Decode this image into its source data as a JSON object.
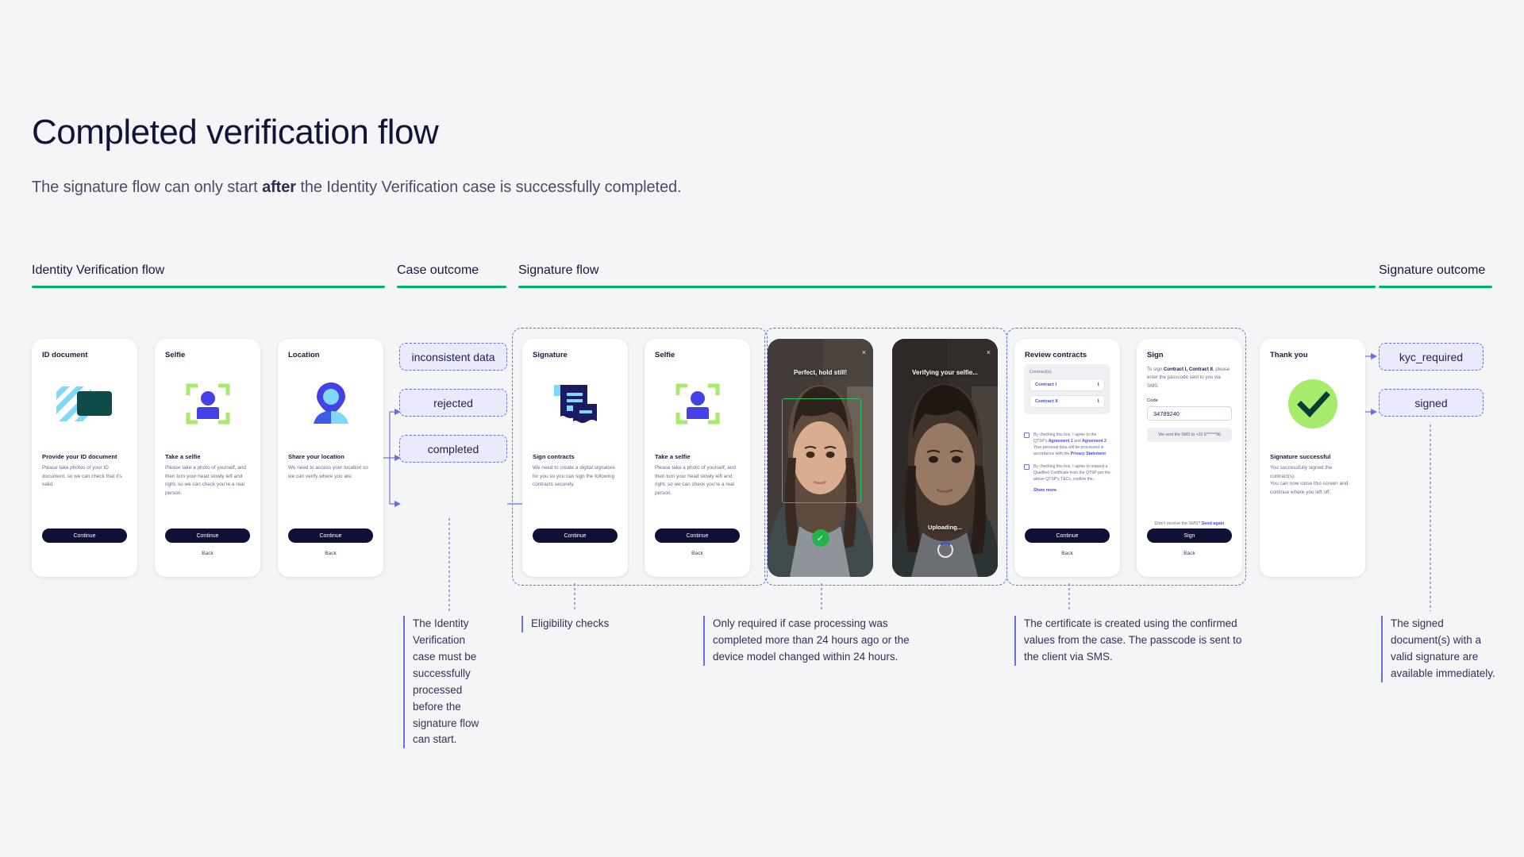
{
  "header": {
    "title": "Completed verification flow",
    "subtitle_pre": "The signature flow can only start ",
    "subtitle_bold": "after",
    "subtitle_post": " the Identity Verification case is successfully completed."
  },
  "sections": [
    {
      "label": "Identity Verification flow"
    },
    {
      "label": "Case outcome"
    },
    {
      "label": "Signature flow"
    },
    {
      "label": "Signature outcome"
    }
  ],
  "screens": {
    "id_document": {
      "title": "ID document",
      "heading": "Provide your ID document",
      "body": "Please take photos of your ID document, so we can check that it's valid.",
      "cta": "Continue",
      "icon": "id-card-icon"
    },
    "selfie": {
      "title": "Selfie",
      "heading": "Take a selfie",
      "body": "Please take a photo of yourself, and then turn your head slowly left and right, so we can check you're a real person.",
      "cta": "Continue",
      "back": "Back",
      "icon": "face-scan-icon"
    },
    "location": {
      "title": "Location",
      "heading": "Share your location",
      "body": "We need to access your location so we can verify where you are.",
      "cta": "Continue",
      "back": "Back",
      "icon": "map-pin-person-icon"
    },
    "signature": {
      "title": "Signature",
      "heading": "Sign contracts",
      "body": "We need to create a digital signature for you so you can sign the following contracts securely.",
      "cta": "Continue",
      "icon": "contract-document-icon"
    },
    "selfie2": {
      "title": "Selfie",
      "heading": "Take a selfie",
      "body": "Please take a photo of yourself, and then turn your head slowly left and right, so we can check you're a real person.",
      "cta": "Continue",
      "back": "Back",
      "icon": "face-scan-icon"
    },
    "camera_hold": {
      "title": "Perfect, hold still!",
      "close": "×",
      "status_icon": "checkmark-circle-icon"
    },
    "camera_verify": {
      "title": "Verifying your selfie...",
      "close": "×",
      "uploading": "Uploading...",
      "spinner_icon": "loading-spinner-icon"
    },
    "review_contracts": {
      "title": "Review contracts",
      "contracts_caption": "Contract(s)",
      "contracts": [
        {
          "name": "Contract I",
          "action_icon": "download-icon"
        },
        {
          "name": "Contract II",
          "action_icon": "download-icon"
        }
      ],
      "consent_1": {
        "p1": "By checking this box, I agree to the QTSP's ",
        "link1": "Agreement 1",
        "p2": " and ",
        "link2": "Agreement 2",
        "p3": ". Your personal data will be processed in accordance with the ",
        "link3": "Privacy Statement",
        "p4": "."
      },
      "consent_2": {
        "text": "By checking this box, I agree to request a Qualified Certificate from the QTSP per the above QTSP's T&Cs, confirm the...",
        "show_more": "Show more"
      },
      "cta": "Continue",
      "back": "Back"
    },
    "sign": {
      "title": "Sign",
      "lead_pre": "To sign ",
      "lead_bold": "Contract I, Contract II",
      "lead_post": ", please enter the passcode sent to you via SMS.",
      "code_label": "Code",
      "code_value": "34789240",
      "sms_note": "We sent the SMS to +31 6******96",
      "resend_pre": "Didn't receive the SMS? ",
      "resend_link": "Send again",
      "cta": "Sign",
      "back": "Back"
    },
    "thank_you": {
      "title": "Thank you",
      "heading": "Signature successful",
      "body_1": "You successfully signed the contract(s).",
      "body_2": "You can now close this screen and continue where you left off.",
      "icon": "success-check-circle-icon"
    }
  },
  "case_outcomes": [
    {
      "label": "inconsistent data"
    },
    {
      "label": "rejected"
    },
    {
      "label": "completed"
    }
  ],
  "signature_outcomes": [
    {
      "label": "kyc_required"
    },
    {
      "label": "signed"
    }
  ],
  "notes": [
    {
      "id": "note-case-completed",
      "text": "The Identity Verification case must be successfully processed  before the signature flow can start."
    },
    {
      "id": "note-eligibility",
      "text": "Eligibility checks"
    },
    {
      "id": "note-selfie-required",
      "text": "Only required if case processing was completed more than 24 hours ago or  the device model changed within 24 hours."
    },
    {
      "id": "note-certificate",
      "text": "The certificate is created using the confirmed values from the case. The passcode is sent to the client via SMS."
    },
    {
      "id": "note-signed-docs",
      "text": "The signed document(s) with a valid signature are available immediately."
    }
  ],
  "colors": {
    "accent_green": "#00b268",
    "flow_purple": "#6b6bf0",
    "pill_bg": "#eaeafc",
    "dark_navy": "#0e1036",
    "lime": "#a6eb6c"
  }
}
